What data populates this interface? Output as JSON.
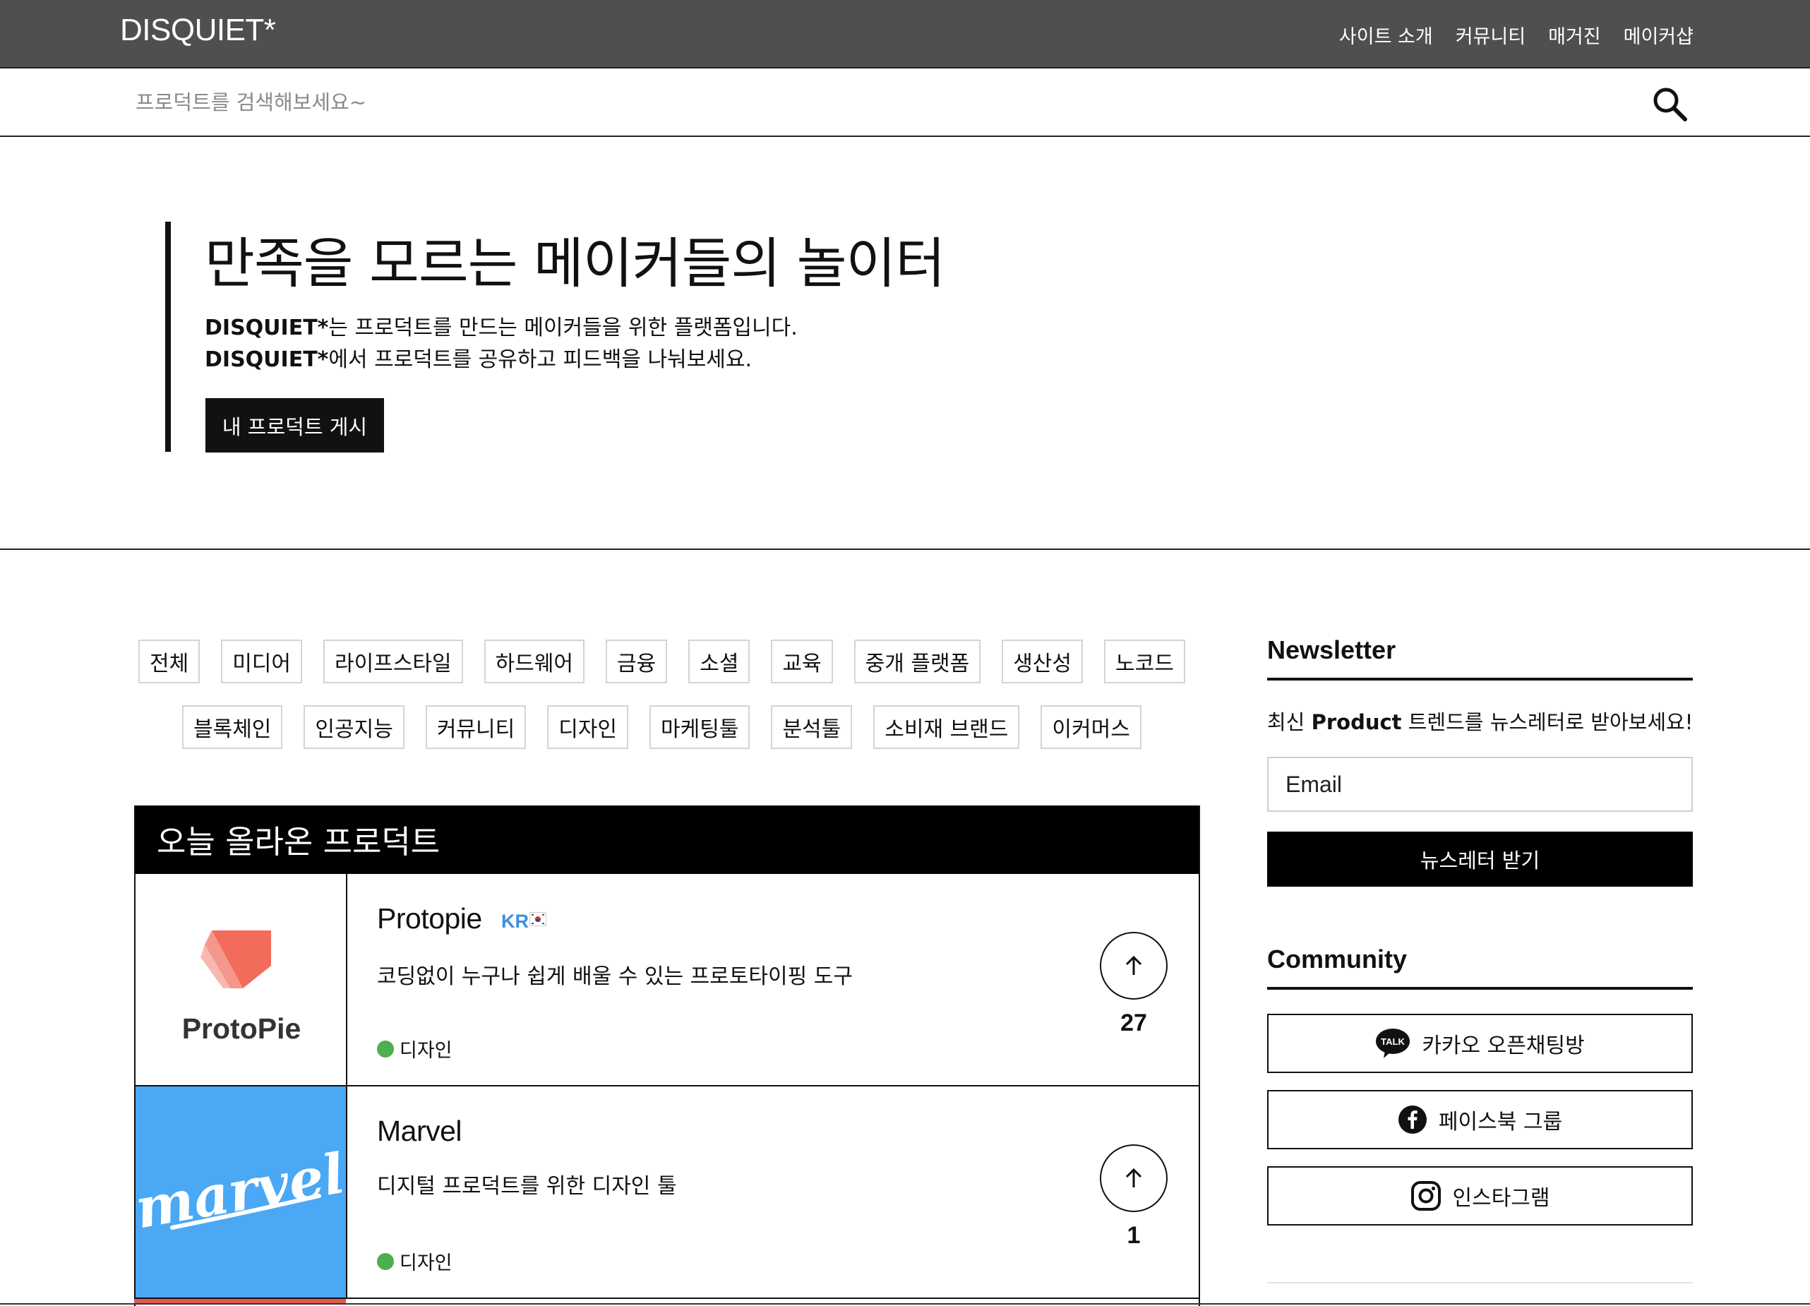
{
  "header": {
    "logo": "DISQUIET*",
    "nav": [
      "사이트 소개",
      "커뮤니티",
      "매거진",
      "메이커샵"
    ]
  },
  "search": {
    "placeholder": "프로덕트를 검색해보세요~",
    "icon": "search-icon"
  },
  "hero": {
    "title": "만족을 모르는 메이커들의 놀이터",
    "line1_brand": "DISQUIET*",
    "line1_text": "는 프로덕트를 만드는 메이커들을 위한 플랫폼입니다.",
    "line2_brand": "DISQUIET*",
    "line2_text": "에서 프로덕트를 공유하고 피드백을 나눠보세요.",
    "button": "내 프로덕트 게시"
  },
  "categories": {
    "row1": [
      "전체",
      "미디어",
      "라이프스타일",
      "하드웨어",
      "금융",
      "소셜",
      "교육",
      "중개 플랫폼",
      "생산성",
      "노코드"
    ],
    "row2": [
      "블록체인",
      "인공지능",
      "커뮤니티",
      "디자인",
      "마케팅툴",
      "분석툴",
      "소비재 브랜드",
      "이커머스"
    ]
  },
  "products": {
    "heading": "오늘 올라온 프로덕트",
    "items": [
      {
        "logo_text": "ProtoPie",
        "name": "Protopie",
        "badge": "KR",
        "description": "코딩없이 누구나 쉽게 배울 수 있는 프로토타이핑 도구",
        "tag": "디자인",
        "upvotes": "27",
        "tag_color": "#4caf50"
      },
      {
        "logo_text": "marvel",
        "name": "Marvel",
        "badge": "",
        "description": "디지털 프로덕트를 위한 디자인 툴",
        "tag": "디자인",
        "upvotes": "1",
        "tag_color": "#4caf50",
        "thumb_color": "#4aa8f5"
      }
    ]
  },
  "sidebar": {
    "newsletter": {
      "heading": "Newsletter",
      "text_prefix": "최신 ",
      "text_bold": "Product",
      "text_suffix": " 트렌드를 뉴스레터로 받아보세요!",
      "email_placeholder": "Email",
      "button": "뉴스레터 받기"
    },
    "community": {
      "heading": "Community",
      "links": [
        {
          "label": "카카오 오픈채팅방",
          "icon": "kakaotalk-icon",
          "icon_text": "TALK"
        },
        {
          "label": "페이스북 그룹",
          "icon": "facebook-icon"
        },
        {
          "label": "인스타그램",
          "icon": "instagram-icon"
        }
      ]
    }
  },
  "colors": {
    "topbar": "#4f4f4f",
    "accent": "#000000",
    "badge": "#3d8fe0",
    "protopie": "#f0564a",
    "marvel": "#4aa8f5"
  }
}
